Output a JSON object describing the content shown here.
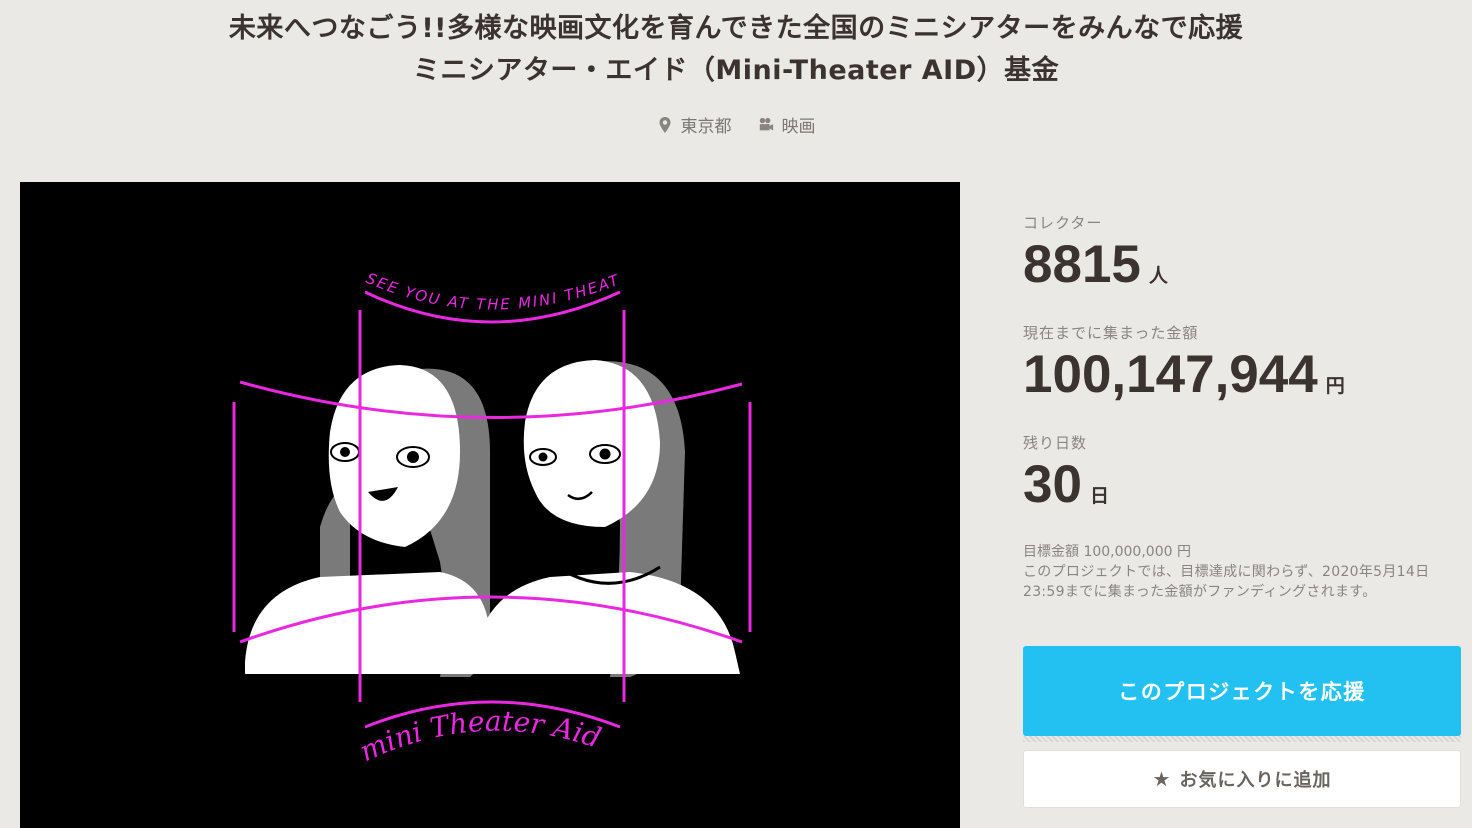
{
  "project": {
    "title_line1": "未来へつなごう!!多様な映画文化を育んできた全国のミニシアターをみんなで応援",
    "title_line2": "ミニシアター・エイド（Mini-Theater AID）基金",
    "location": "東京都",
    "category": "映画",
    "location_icon": "map-pin-icon",
    "category_icon": "movie-camera-icon"
  },
  "hero": {
    "top_text": "SEE YOU AT THE MINI THEATER.",
    "bottom_text": "mini Theater Aid",
    "accent_color": "#e829e0"
  },
  "stats": {
    "collectors_label": "コレクター",
    "collectors_value": "8815",
    "collectors_unit": "人",
    "raised_label": "現在までに集まった金額",
    "raised_value": "100,147,944",
    "raised_unit": "円",
    "days_label": "残り日数",
    "days_value": "30",
    "days_unit": "日",
    "goal": "目標金額 100,000,000 円",
    "note": "このプロジェクトでは、目標達成に関わらず、2020年5月14日23:59までに集まった金額がファンディングされます。"
  },
  "actions": {
    "support_label": "このプロジェクトを応援",
    "favorite_label": "お気に入りに追加",
    "favorite_icon": "star-icon",
    "support_color": "#23c1f1"
  }
}
